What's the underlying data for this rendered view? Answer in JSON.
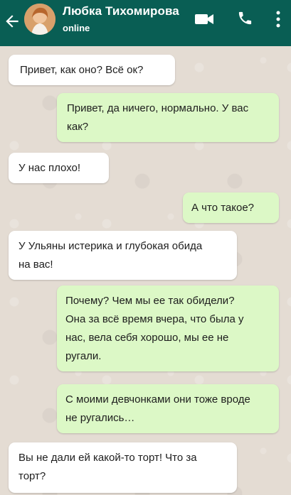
{
  "header": {
    "contact_name": "Любка Тихомирова",
    "status": "online",
    "icons": [
      "back-arrow-icon",
      "avatar",
      "video-call-icon",
      "phone-icon",
      "more-menu-icon"
    ]
  },
  "colors": {
    "header": "#095e54",
    "incoming_bubble": "#ffffff",
    "outgoing_bubble": "#dcf8c6",
    "chat_background": "#e4dcd3"
  },
  "messages": [
    {
      "direction": "incoming",
      "text": "Привет, как оно? Всё ок?"
    },
    {
      "direction": "outgoing",
      "text": "Привет, да ничего, нормально. У вас\nкак?"
    },
    {
      "direction": "incoming",
      "text": "У нас плохо!"
    },
    {
      "direction": "outgoing",
      "text": "А что такое?"
    },
    {
      "direction": "incoming",
      "text": "У Ульяны истерика и глубокая обида\nна вас!"
    },
    {
      "direction": "outgoing",
      "text": "Почему? Чем мы ее так обидели?\nОна за всё время вчера, что была у\nнас, вела себя хорошо, мы ее не\nругали."
    },
    {
      "direction": "outgoing",
      "text": "С моими девчонками они тоже вроде\nне ругались…"
    },
    {
      "direction": "incoming",
      "text": "Вы не дали ей какой-то торт! Что за\nторт?"
    }
  ]
}
